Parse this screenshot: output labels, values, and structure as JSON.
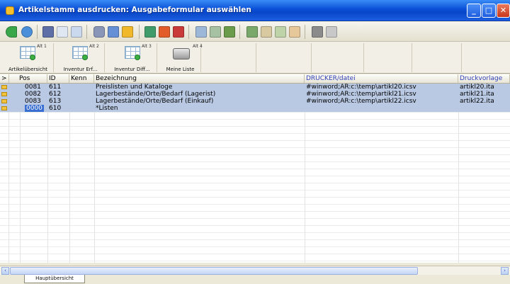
{
  "window": {
    "title": "Artikelstamm ausdrucken: Ausgabeformular auswählen",
    "min_glyph": "_",
    "max_glyph": "□",
    "close_glyph": "✕"
  },
  "toolbar": {
    "icons": [
      "back-arrow-icon",
      "refresh-icon",
      "book-icon",
      "list-view-icon",
      "grid-view-icon",
      "database-icon",
      "table-icon",
      "wand-icon",
      "link-icon",
      "record-icon",
      "delete-icon",
      "fax-icon",
      "send-icon",
      "export-icon",
      "import-icon",
      "report-icon",
      "edit-report-icon",
      "document-icon",
      "tools-icon",
      "trash-icon"
    ]
  },
  "ribbon": {
    "buttons": [
      {
        "label": "Artikelübersicht",
        "tag": "Alt 1"
      },
      {
        "label": "Inventur Erf...",
        "tag": "Alt 2"
      },
      {
        "label": "Inventur Diff...",
        "tag": "Alt 3"
      },
      {
        "label": "Meine Liste",
        "tag": "Alt 4"
      }
    ]
  },
  "table": {
    "headers": {
      "marker": ">",
      "pos": "Pos",
      "id": "ID",
      "kenn": "Kenn",
      "bezeichnung": "Bezeichnung",
      "drucker": "DRUCKER/datei",
      "vorlage": "Druckvorlage"
    },
    "rows": [
      {
        "pos": "0081",
        "id": "611",
        "kenn": "",
        "bezeichnung": "Preislisten und Kataloge",
        "drucker": "#winword;AR:c:\\temp\\artikl20.icsv",
        "vorlage": "artikl20.ita"
      },
      {
        "pos": "0082",
        "id": "612",
        "kenn": "",
        "bezeichnung": "Lagerbestände/Orte/Bedarf (Lagerist)",
        "drucker": "#winword;AR:c:\\temp\\artikl21.icsv",
        "vorlage": "artikl21.ita"
      },
      {
        "pos": "0083",
        "id": "613",
        "kenn": "",
        "bezeichnung": "Lagerbestände/Orte/Bedarf (Einkauf)",
        "drucker": "#winword;AR:c:\\temp\\artikl22.icsv",
        "vorlage": "artikl22.ita"
      },
      {
        "pos": "0000",
        "id": "610",
        "kenn": "",
        "bezeichnung": "*Listen",
        "drucker": "",
        "vorlage": ""
      }
    ]
  },
  "scroll": {
    "left": "‹",
    "right": "›"
  },
  "tabs": [
    {
      "label": "Hauptübersicht"
    }
  ]
}
